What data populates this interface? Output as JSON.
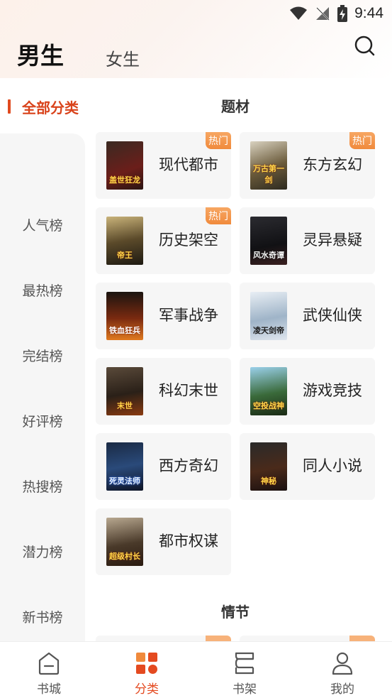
{
  "status": {
    "time": "9:44"
  },
  "header": {
    "tab_male": "男生",
    "tab_female": "女生"
  },
  "sidebar": {
    "all_label": "全部分类",
    "items": [
      {
        "label": "人气榜"
      },
      {
        "label": "最热榜"
      },
      {
        "label": "完结榜"
      },
      {
        "label": "好评榜"
      },
      {
        "label": "热搜榜"
      },
      {
        "label": "潜力榜"
      },
      {
        "label": "新书榜"
      }
    ]
  },
  "sections": [
    {
      "title": "题材",
      "cards": [
        {
          "label": "现代都市",
          "hot": "热门",
          "cover_text": "盖世狂龙"
        },
        {
          "label": "东方玄幻",
          "hot": "热门",
          "cover_text": "万古第一剑"
        },
        {
          "label": "历史架空",
          "hot": "热门",
          "cover_text": "帝王"
        },
        {
          "label": "灵异悬疑",
          "hot": "",
          "cover_text": "风水奇谭"
        },
        {
          "label": "军事战争",
          "hot": "",
          "cover_text": "铁血狂兵"
        },
        {
          "label": "武侠仙侠",
          "hot": "",
          "cover_text": "凌天剑帝"
        },
        {
          "label": "科幻末世",
          "hot": "",
          "cover_text": "末世"
        },
        {
          "label": "游戏竞技",
          "hot": "",
          "cover_text": "空投战神"
        },
        {
          "label": "西方奇幻",
          "hot": "",
          "cover_text": "死灵法师"
        },
        {
          "label": "同人小说",
          "hot": "",
          "cover_text": "神秘"
        },
        {
          "label": "都市权谋",
          "hot": "",
          "cover_text": "超级村长"
        }
      ]
    },
    {
      "title": "情节"
    }
  ],
  "bottom_nav": [
    {
      "label": "书城"
    },
    {
      "label": "分类"
    },
    {
      "label": "书架"
    },
    {
      "label": "我的"
    }
  ],
  "colors": {
    "accent": "#e44a20",
    "hot_badge": "#f08a3c",
    "card_bg": "#f6f6f6"
  }
}
